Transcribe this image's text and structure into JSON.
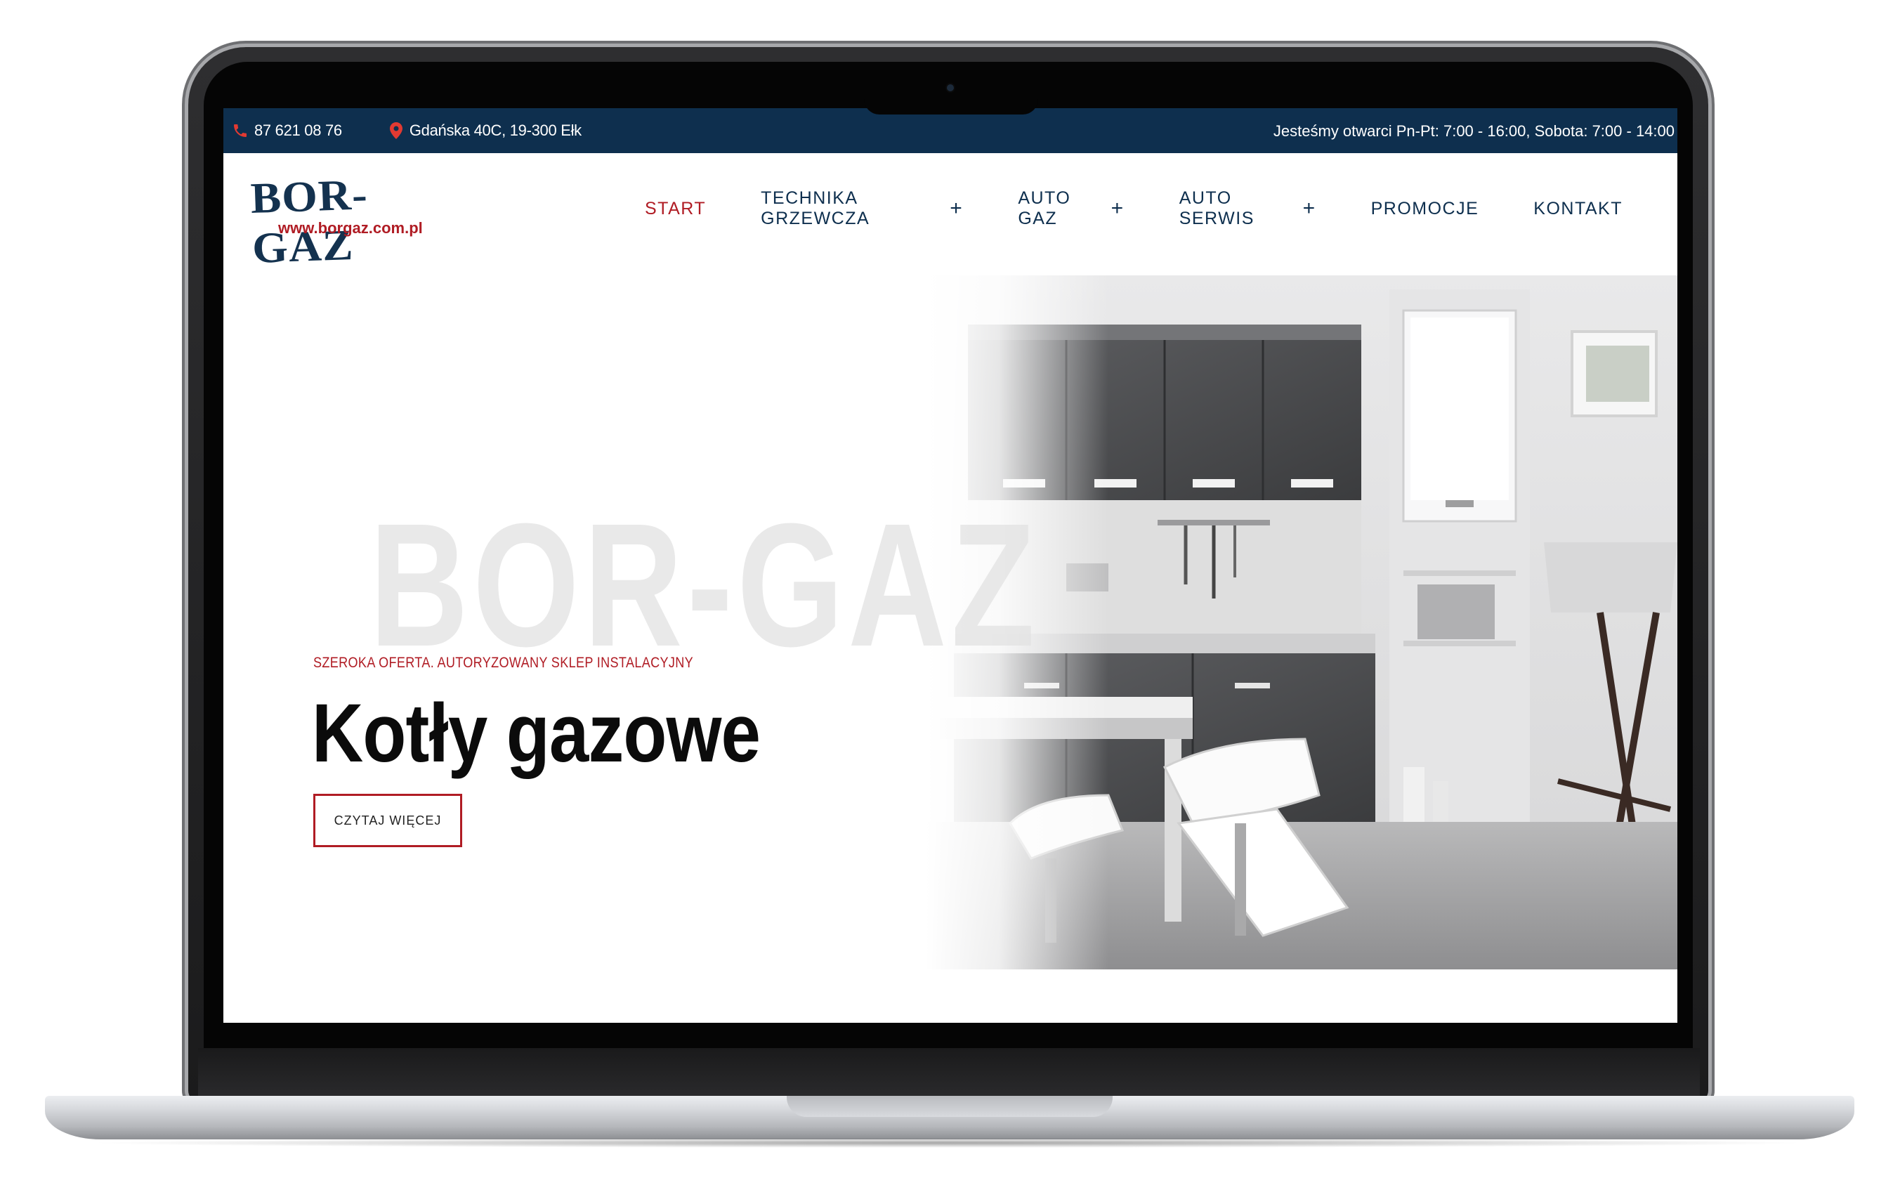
{
  "topbar": {
    "phone": "87 621 08 76",
    "address": "Gdańska 40C, 19-300 Ełk",
    "hours": "Jesteśmy otwarci Pn-Pt: 7:00 - 16:00, Sobota: 7:00 - 14:00"
  },
  "logo": {
    "name": "BOR-GAZ",
    "url": "www.borgaz.com.pl"
  },
  "nav": {
    "items": [
      {
        "label": "START"
      },
      {
        "label": "TECHNIKA GRZEWCZA"
      },
      {
        "label": "AUTO GAZ"
      },
      {
        "label": "AUTO SERWIS"
      },
      {
        "label": "PROMOCJE"
      },
      {
        "label": "KONTAKT"
      }
    ]
  },
  "hero": {
    "watermark": "BOR-GAZ",
    "eyebrow": "SZEROKA OFERTA. AUTORYZOWANY SKLEP INSTALACYJNY",
    "title": "Kotły gazowe",
    "cta": "CZYTAJ WIĘCEJ"
  },
  "colors": {
    "navy": "#0e2f4e",
    "accent_red": "#b01c24",
    "text_dark": "#0b0b0b"
  },
  "icons": [
    "phone-icon",
    "map-pin-icon",
    "plus-icon"
  ]
}
